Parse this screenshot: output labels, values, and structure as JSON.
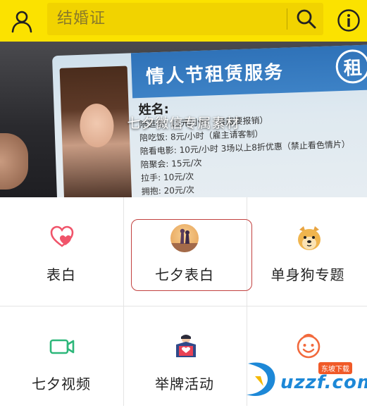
{
  "header": {
    "search_text": "结婚证",
    "user_icon": "user-icon",
    "search_icon": "search-icon",
    "info_icon": "info-icon",
    "color": "#fbe200"
  },
  "banner": {
    "caption": "七夕微信专属素材",
    "card_title": "情人节租赁服务",
    "card_badge": "租",
    "card_name": "姓名:",
    "card_lines": [
      "陪逛街: 15元/小时（鞋服要报销）",
      "陪吃饭: 8元/小时（雇主请客制）",
      "陪看电影: 10元/小时  3场以上8折优惠（禁止看色情片）",
      "陪聚会: 15元/次",
      "拉手: 10元/次",
      "拥抱: 20元/次"
    ],
    "slides_total": 4,
    "active_slide": 3
  },
  "grid": {
    "items": [
      {
        "label": "表白",
        "icon": "heart-icon"
      },
      {
        "label": "七夕表白",
        "icon": "couple-avatar-icon",
        "selected": true
      },
      {
        "label": "单身狗专题",
        "icon": "doge-icon"
      },
      {
        "label": "七夕视频",
        "icon": "video-camera-icon"
      },
      {
        "label": "举牌活动",
        "icon": "sign-holding-icon"
      },
      {
        "label": "",
        "icon": "smiley-face-icon"
      }
    ]
  },
  "watermark": {
    "text": "uzzf.com",
    "tag": "东坡下载"
  },
  "colors": {
    "accent": "#fbe200",
    "selected_border": "#c2413f",
    "heart": "#f0546a",
    "video": "#2db77a",
    "smiley": "#f26a3d"
  }
}
